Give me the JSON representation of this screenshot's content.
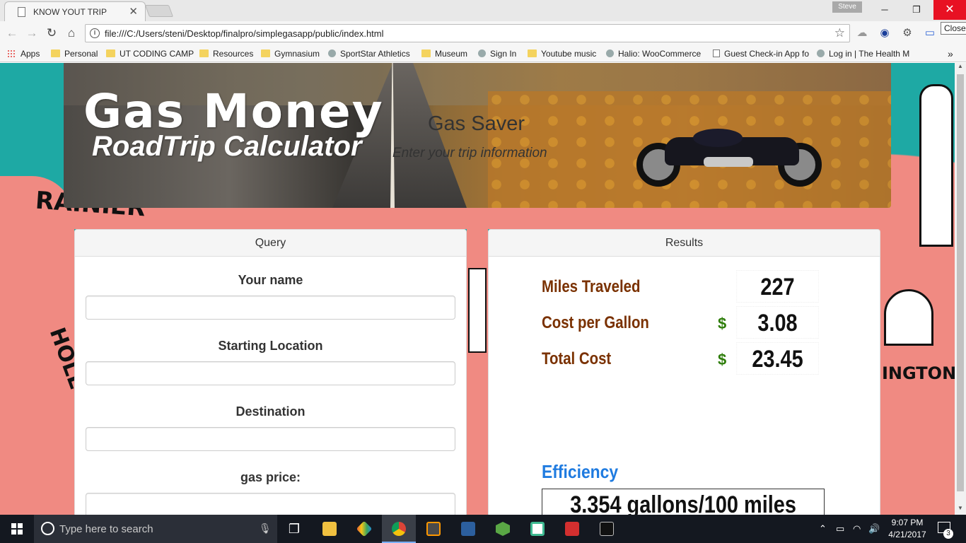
{
  "browser": {
    "tab_title": "KNOW YOUT TRIP",
    "user": "Steve",
    "close_tooltip": "Close",
    "url": "file:///C:/Users/steni/Desktop/finalpro/simplegasapp/public/index.html",
    "bookmarks": [
      {
        "label": "Apps",
        "icon": "apps"
      },
      {
        "label": "Personal",
        "icon": "folder"
      },
      {
        "label": "UT CODING CAMP",
        "icon": "folder"
      },
      {
        "label": "Resources",
        "icon": "folder"
      },
      {
        "label": "Gymnasium",
        "icon": "folder"
      },
      {
        "label": "SportStar Athletics",
        "icon": "generic"
      },
      {
        "label": "Museum",
        "icon": "folder"
      },
      {
        "label": "Sign In",
        "icon": "generic"
      },
      {
        "label": "Youtube music",
        "icon": "folder"
      },
      {
        "label": "Halio: WooCommerce",
        "icon": "generic"
      },
      {
        "label": "Guest Check-in App fo",
        "icon": "page"
      },
      {
        "label": "Log in | The Health M",
        "icon": "generic"
      }
    ]
  },
  "header": {
    "title": "Gas Money",
    "subtitle": "RoadTrip Calculator",
    "tagline": "Gas Saver",
    "instruction": "Enter your trip information"
  },
  "query": {
    "heading": "Query",
    "fields": [
      {
        "label": "Your name",
        "value": ""
      },
      {
        "label": "Starting Location",
        "value": ""
      },
      {
        "label": "Destination",
        "value": ""
      },
      {
        "label": "gas price:",
        "value": ""
      }
    ]
  },
  "results": {
    "heading": "Results",
    "miles_label": "Miles Traveled",
    "miles_value": "227",
    "cpg_label": "Cost per Gallon",
    "cpg_currency": "$",
    "cpg_value": "3.08",
    "total_label": "Total Cost",
    "total_currency": "$",
    "total_value": "23.45",
    "efficiency_label": "Efficiency",
    "efficiency_value": "3.354 gallons/100 miles"
  },
  "taskbar": {
    "search_placeholder": "Type here to search",
    "time": "9:07 PM",
    "date": "4/21/2017",
    "notifications": "3"
  },
  "colors": {
    "teal_background": "#1ea9a4",
    "salmon_map": "#f08a82",
    "result_label": "#7a3100",
    "dollar_green": "#2e7d0a",
    "efficiency_blue": "#1f7be0",
    "close_red": "#e81123"
  }
}
